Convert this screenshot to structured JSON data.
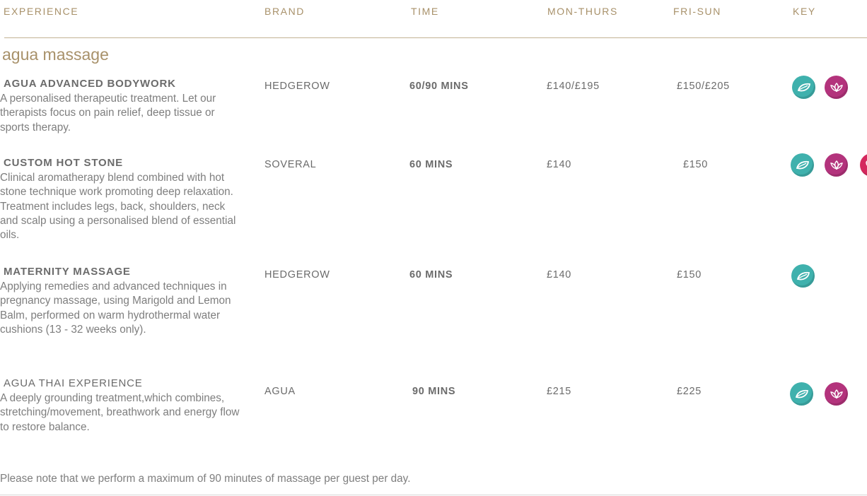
{
  "columns": {
    "experience": "EXPERIENCE",
    "brand": "BRAND",
    "time": "TIME",
    "mon_thurs": "MON-THURS",
    "fri_sun": "FRI-SUN",
    "key": "KEY"
  },
  "section_title": "agua massage",
  "treatments": [
    {
      "title": "AGUA ADVANCED BODYWORK",
      "description": "A personalised therapeutic treatment. Let our therapists focus on pain relief, deep tissue or sports therapy.",
      "brand": "HEDGEROW",
      "time": "60/90 MINS",
      "mon_thurs": "£140/£195",
      "fri_sun": "£150/£205",
      "keys": [
        "leaf-icon",
        "lotus-icon"
      ]
    },
    {
      "title": "CUSTOM HOT STONE",
      "description": "Clinical aromatherapy blend combined with hot stone technique work promoting deep relaxation. Treatment includes legs, back, shoulders, neck and scalp using a personalised blend of essential oils.",
      "brand": "SOVERAL",
      "time": "60 MINS",
      "mon_thurs": "£140",
      "fri_sun": "£150",
      "keys": [
        "leaf-icon",
        "lotus-icon",
        "heart-icon"
      ]
    },
    {
      "title": "MATERNITY MASSAGE",
      "description": "Applying remedies and advanced techniques in pregnancy massage, using Marigold and Lemon Balm, performed on warm hydrothermal water cushions (13 - 32 weeks only).",
      "brand": "HEDGEROW",
      "time": "60 MINS",
      "mon_thurs": "£140",
      "fri_sun": "£150",
      "keys": [
        "leaf-icon"
      ]
    },
    {
      "title": "AGUA THAI EXPERIENCE",
      "description": "A deeply grounding treatment,which combines, stretching/movement, breathwork and energy flow to restore balance.",
      "brand": "AGUA",
      "time": "90 MINS",
      "mon_thurs": "£215",
      "fri_sun": "£225",
      "keys": [
        "leaf-icon",
        "lotus-icon"
      ]
    }
  ],
  "note": "Please note that we perform a maximum of 90 minutes of massage per guest per day.",
  "colors": {
    "accent": "#a8916a",
    "leaf": "#3fb1ad",
    "lotus": "#b3337c",
    "third": "#d4275d"
  }
}
